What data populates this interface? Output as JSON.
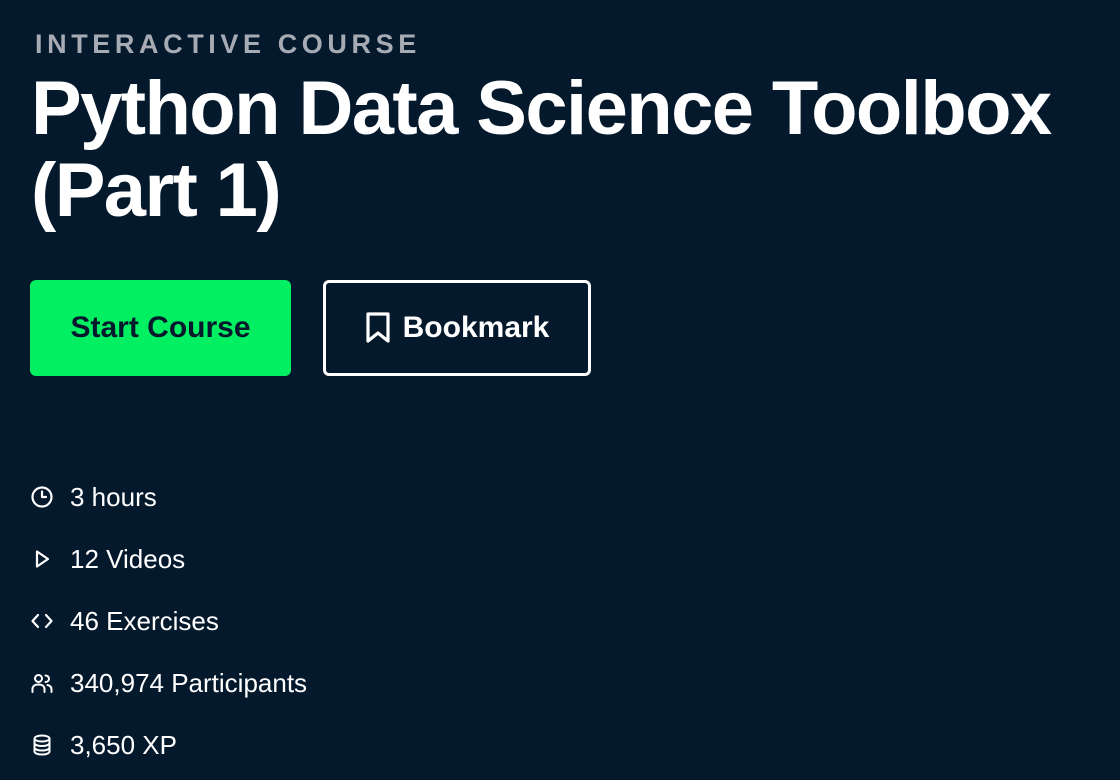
{
  "header": {
    "eyebrow": "INTERACTIVE COURSE",
    "title": "Python Data Science Toolbox (Part 1)"
  },
  "actions": {
    "start_label": "Start Course",
    "bookmark_label": "Bookmark"
  },
  "stats": [
    {
      "icon": "clock-icon",
      "label": "3 hours"
    },
    {
      "icon": "play-icon",
      "label": "12 Videos"
    },
    {
      "icon": "code-icon",
      "label": "46 Exercises"
    },
    {
      "icon": "users-icon",
      "label": "340,974 Participants"
    },
    {
      "icon": "database-icon",
      "label": "3,650 XP"
    }
  ],
  "colors": {
    "background": "#05192d",
    "accent": "#03ef62",
    "eyebrow": "#a6abb4",
    "text": "#ffffff"
  }
}
